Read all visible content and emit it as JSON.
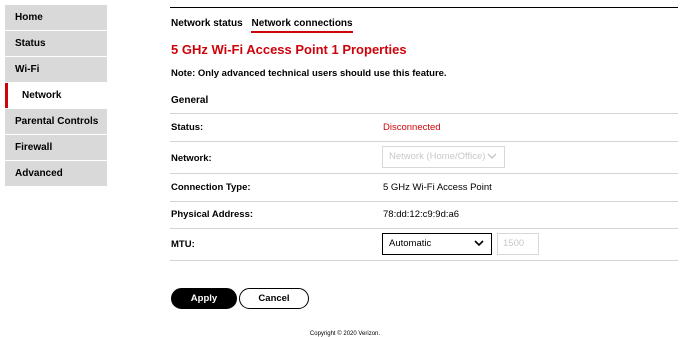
{
  "sidebar": {
    "items": [
      {
        "label": "Home"
      },
      {
        "label": "Status"
      },
      {
        "label": "Wi-Fi"
      },
      {
        "label": "Network"
      },
      {
        "label": "Parental Controls"
      },
      {
        "label": "Firewall"
      },
      {
        "label": "Advanced"
      }
    ],
    "active": "Network"
  },
  "tabs": [
    {
      "label": "Network status"
    },
    {
      "label": "Network connections"
    }
  ],
  "active_tab": "Network connections",
  "page_title": "5 GHz Wi-Fi Access Point 1 Properties",
  "note": "Note: Only advanced technical users should use this feature.",
  "section_title": "General",
  "rows": {
    "status": {
      "label": "Status:",
      "value": "Disconnected"
    },
    "network": {
      "label": "Network:",
      "value": "Network (Home/Office)"
    },
    "connection_type": {
      "label": "Connection Type:",
      "value": "5 GHz Wi-Fi Access Point"
    },
    "physical_address": {
      "label": "Physical Address:",
      "value": "78:dd:12:c9:9d:a6"
    },
    "mtu": {
      "label": "MTU:",
      "value": "Automatic",
      "input_value": "1500"
    }
  },
  "buttons": {
    "apply": "Apply",
    "cancel": "Cancel"
  },
  "footer": {
    "copyright": "Copyright © 2020 Verizon."
  },
  "colors": {
    "accent": "#cd040b",
    "sidebar_bg": "#d9d9d9"
  },
  "icons": {
    "dropdown": "chevron-down-icon"
  }
}
